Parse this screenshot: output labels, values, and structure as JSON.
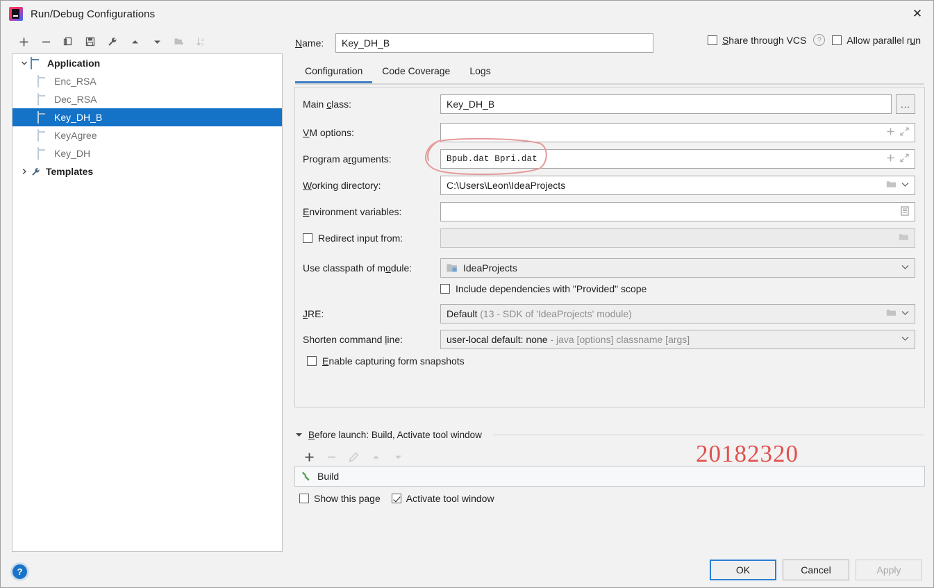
{
  "window": {
    "title": "Run/Debug Configurations",
    "app_icon": "intellij-idea-icon",
    "close_icon": "close-icon"
  },
  "left_toolbar": {
    "buttons": [
      {
        "name": "add-configuration-button",
        "icon": "plus-icon",
        "enabled": true
      },
      {
        "name": "remove-configuration-button",
        "icon": "minus-icon",
        "enabled": true
      },
      {
        "name": "copy-configuration-button",
        "icon": "copy-icon",
        "enabled": true
      },
      {
        "name": "save-configuration-button",
        "icon": "save-icon",
        "enabled": true
      },
      {
        "name": "edit-templates-button",
        "icon": "wrench-icon",
        "enabled": true
      },
      {
        "name": "move-up-button",
        "icon": "arrow-up-icon",
        "enabled": true
      },
      {
        "name": "move-down-button",
        "icon": "arrow-down-icon",
        "enabled": true
      },
      {
        "name": "move-into-folder-button",
        "icon": "folder-add-icon",
        "enabled": false
      },
      {
        "name": "sort-configurations-button",
        "icon": "sort-az-icon",
        "enabled": false
      }
    ]
  },
  "tree": {
    "nodes": [
      {
        "label": "Application",
        "level": 1,
        "bold": true,
        "expanded": true,
        "icon": "application-icon",
        "selected": false
      },
      {
        "label": "Enc_RSA",
        "level": 2,
        "bold": false,
        "icon": "configuration-icon",
        "selected": false
      },
      {
        "label": "Dec_RSA",
        "level": 2,
        "bold": false,
        "icon": "configuration-icon",
        "selected": false
      },
      {
        "label": "Key_DH_B",
        "level": 2,
        "bold": false,
        "icon": "configuration-icon",
        "selected": true
      },
      {
        "label": "KeyAgree",
        "level": 2,
        "bold": false,
        "icon": "configuration-icon",
        "selected": false
      },
      {
        "label": "Key_DH",
        "level": 2,
        "bold": false,
        "icon": "configuration-icon",
        "selected": false
      },
      {
        "label": "Templates",
        "level": 1,
        "bold": true,
        "expanded": false,
        "icon": "wrench-icon",
        "selected": false
      }
    ]
  },
  "header": {
    "name_label": "Name:",
    "name_value": "Key_DH_B",
    "share_vcs_label": "Share through VCS",
    "share_vcs_checked": false,
    "help_icon": "help-icon",
    "allow_parallel_label": "Allow parallel run",
    "allow_parallel_checked": false
  },
  "tabs": [
    {
      "label": "Configuration",
      "active": true
    },
    {
      "label": "Code Coverage",
      "active": false
    },
    {
      "label": "Logs",
      "active": false
    }
  ],
  "form": {
    "main_class": {
      "label": "Main class:",
      "value": "Key_DH_B",
      "browse_label": "...",
      "browse_icon": "ellipsis-icon"
    },
    "vm_options": {
      "label": "VM options:",
      "value": "",
      "add_icon": "plus-icon",
      "expand_icon": "expand-icon"
    },
    "program_arguments": {
      "label": "Program arguments:",
      "value": "Bpub.dat Bpri.dat",
      "add_icon": "plus-icon",
      "expand_icon": "expand-icon"
    },
    "working_directory": {
      "label": "Working directory:",
      "value": "C:\\Users\\Leon\\IdeaProjects",
      "folder_icon": "folder-icon",
      "dropdown_icon": "chevron-down-icon"
    },
    "environment_variables": {
      "label": "Environment variables:",
      "value": "",
      "editor_icon": "list-editor-icon"
    },
    "redirect_input": {
      "label": "Redirect input from:",
      "checked": false,
      "value": "",
      "folder_icon": "folder-icon"
    },
    "classpath_module": {
      "label": "Use classpath of module:",
      "value": "IdeaProjects",
      "module_icon": "module-icon",
      "dropdown_icon": "chevron-down-icon"
    },
    "include_provided": {
      "label": "Include dependencies with \"Provided\" scope",
      "checked": false
    },
    "jre": {
      "label": "JRE:",
      "value": "Default",
      "value_hint": "(13 - SDK of 'IdeaProjects' module)",
      "folder_icon": "folder-icon",
      "dropdown_icon": "chevron-down-icon"
    },
    "shorten_command_line": {
      "label": "Shorten command line:",
      "value": "user-local default: none",
      "value_hint": "- java [options] classname [args]",
      "dropdown_icon": "chevron-down-icon"
    },
    "form_snapshots": {
      "label": "Enable capturing form snapshots",
      "checked": false
    }
  },
  "before_launch": {
    "header": "Before launch: Build, Activate tool window",
    "collapse_icon": "triangle-down-icon",
    "toolbar": [
      {
        "name": "add-task-button",
        "icon": "plus-icon",
        "enabled": true
      },
      {
        "name": "remove-task-button",
        "icon": "minus-icon",
        "enabled": false
      },
      {
        "name": "edit-task-button",
        "icon": "pencil-icon",
        "enabled": false
      },
      {
        "name": "move-task-up-button",
        "icon": "arrow-up-icon",
        "enabled": false
      },
      {
        "name": "move-task-down-button",
        "icon": "arrow-down-icon",
        "enabled": false
      }
    ],
    "tasks": [
      {
        "label": "Build",
        "icon": "build-hammer-icon"
      }
    ],
    "show_this_page_label": "Show this page",
    "show_this_page_checked": false,
    "activate_tool_window_label": "Activate tool window",
    "activate_tool_window_checked": true
  },
  "annotations": {
    "student_number": "20182320",
    "annotation_color": "#e0514d",
    "ellipse_target": "program-arguments-field"
  },
  "footer": {
    "help_icon": "help-icon",
    "help_glyph": "?",
    "ok_label": "OK",
    "cancel_label": "Cancel",
    "apply_label": "Apply",
    "apply_enabled": false
  },
  "colors": {
    "selection_blue": "#1472c7",
    "tab_accent": "#3c7ec4",
    "annotation_red": "#e0514d",
    "dialog_bg": "#f2f2f2"
  }
}
